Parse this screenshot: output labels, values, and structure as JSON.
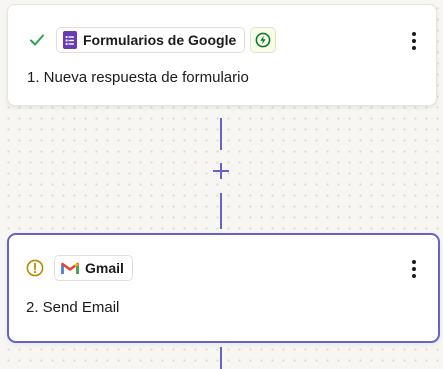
{
  "trigger_step": {
    "app_name": "Formularios de Google",
    "step_label": "1. Nueva respuesta de formulario",
    "status_icon": "check-icon",
    "app_icon": "google-forms-icon",
    "instant_icon": "bolt-icon"
  },
  "action_step": {
    "app_name": "Gmail",
    "step_label": "2. Send Email",
    "status_icon": "warning-icon",
    "app_icon": "gmail-icon"
  },
  "connector": {
    "add_icon": "plus-icon"
  },
  "colors": {
    "accent": "#6762c8",
    "success": "#2ea44f",
    "warning": "#b88a00",
    "forms_purple": "#673ab7",
    "bolt_green": "#0f7a2e",
    "background": "#f7f6f3"
  }
}
